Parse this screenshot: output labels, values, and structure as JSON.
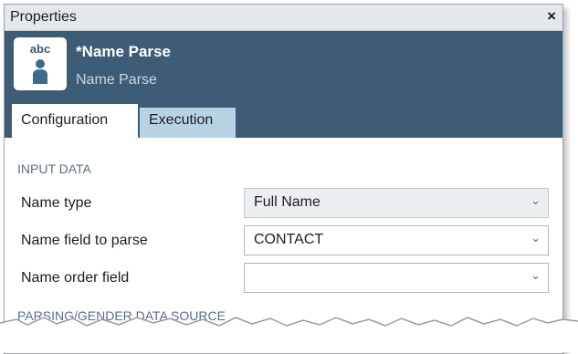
{
  "window": {
    "title": "Properties",
    "close_label": "×"
  },
  "header": {
    "icon_text": "abc",
    "title": "*Name Parse",
    "subtitle": "Name Parse"
  },
  "tabs": [
    {
      "label": "Configuration",
      "active": true
    },
    {
      "label": "Execution",
      "active": false
    }
  ],
  "section_input": "INPUT DATA",
  "fields": [
    {
      "label": "Name type",
      "value": "Full Name"
    },
    {
      "label": "Name field to parse",
      "value": "CONTACT"
    },
    {
      "label": "Name order field",
      "value": ""
    }
  ],
  "section_parsing": "PARSING/GENDER DATA SOURCE",
  "colors": {
    "header": "#3d5c75",
    "inactive_tab": "#b9d3e6",
    "titlebar": "#e4e8ec"
  },
  "icons": {
    "close": "close-icon",
    "app": "person-icon",
    "dropdown": "chevron-down-icon"
  }
}
